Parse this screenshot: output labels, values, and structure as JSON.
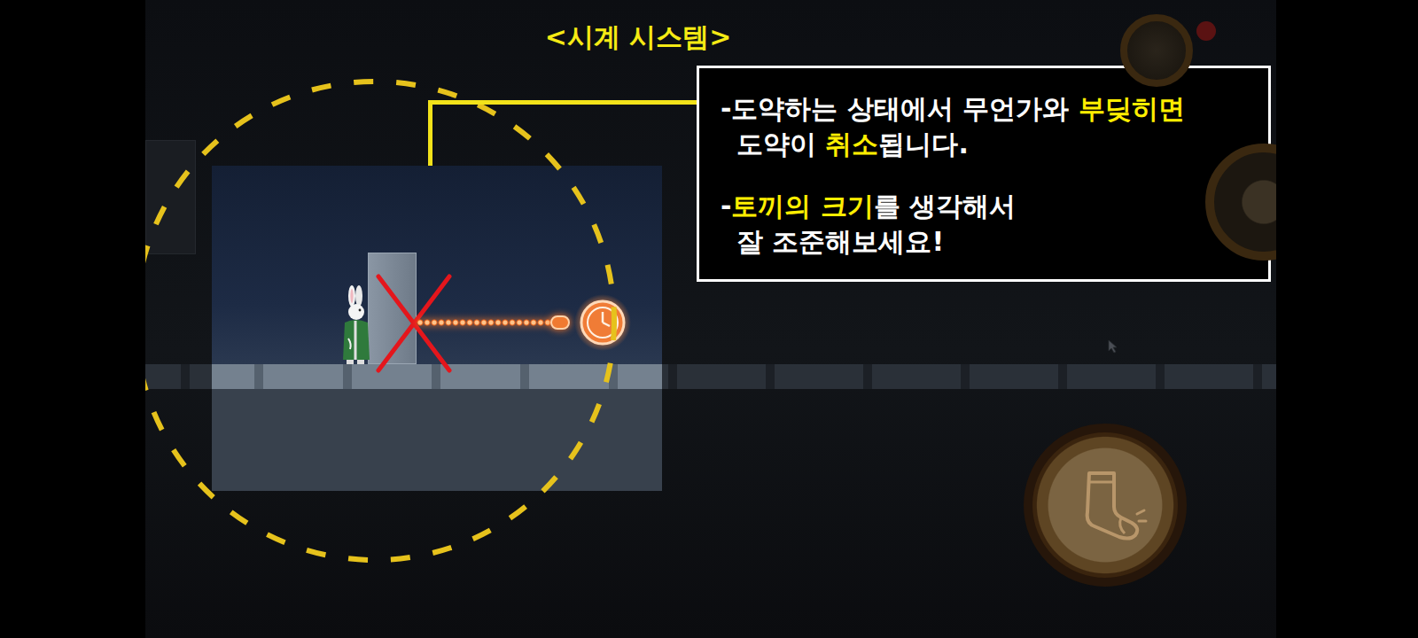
{
  "title": "<시계 시스템>",
  "callout": {
    "paragraphs": [
      {
        "lines": [
          [
            {
              "text": "-도약하는 상태에서 무언가와 ",
              "highlight": false
            },
            {
              "text": "부딪히면",
              "highlight": true
            }
          ],
          [
            {
              "text": "도약이 ",
              "highlight": false
            },
            {
              "text": "취소",
              "highlight": true
            },
            {
              "text": "됩니다.",
              "highlight": false
            }
          ]
        ]
      },
      {
        "lines": [
          [
            {
              "text": "-",
              "highlight": false
            },
            {
              "text": "토끼의 크기",
              "highlight": true
            },
            {
              "text": "를 생각해서",
              "highlight": false
            }
          ],
          [
            {
              "text": "잘 조준해보세요!",
              "highlight": false
            }
          ]
        ]
      }
    ]
  },
  "scene": {
    "jump_cancelled": true
  }
}
